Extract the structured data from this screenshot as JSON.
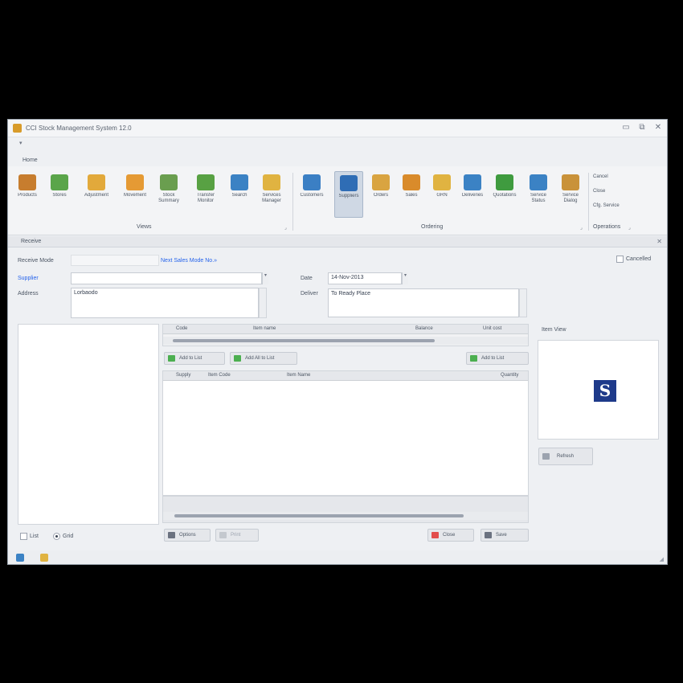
{
  "app": {
    "title": "CCI Stock Management System 12.0",
    "window_controls": {
      "minimize": "▭",
      "restore": "⧉",
      "close": "✕"
    },
    "qat_arrow": "▾"
  },
  "menu": {
    "active_tab": "Home"
  },
  "ribbon": {
    "groups": [
      {
        "label": "Views",
        "buttons": [
          {
            "label": "Products",
            "icon": "box-icon",
            "color": "#c77d2e"
          },
          {
            "label": "Stores",
            "icon": "store-icon",
            "color": "#5aa54a"
          },
          {
            "label": "Adjustment",
            "icon": "adjustment-icon",
            "color": "#e2a93b"
          },
          {
            "label": "Movement",
            "icon": "movement-icon",
            "color": "#e59a34"
          },
          {
            "label": "Stock Summary",
            "icon": "summary-icon",
            "color": "#6a9e4f"
          },
          {
            "label": "Transfer Monitor",
            "icon": "monitor-icon",
            "color": "#58a143"
          },
          {
            "label": "Search",
            "icon": "search-icon",
            "color": "#3b82c4"
          },
          {
            "label": "Services Manager",
            "icon": "services-icon",
            "color": "#e0b341"
          }
        ]
      },
      {
        "label": "Ordering",
        "buttons": [
          {
            "label": "Customers",
            "icon": "customers-icon",
            "color": "#3b7fc4"
          },
          {
            "label": "Suppliers",
            "icon": "suppliers-icon",
            "color": "#2f6db5"
          },
          {
            "label": "Orders",
            "icon": "orders-icon",
            "color": "#d9a441"
          },
          {
            "label": "Sales",
            "icon": "sales-icon",
            "color": "#d98b2b"
          },
          {
            "label": "GRN",
            "icon": "grn-icon",
            "color": "#e0b341"
          },
          {
            "label": "Deliveries",
            "icon": "deliveries-icon",
            "color": "#3b82c4"
          },
          {
            "label": "Quotations",
            "icon": "quotations-icon",
            "color": "#3f9b3f"
          },
          {
            "label": "Service Status",
            "icon": "service-status-icon",
            "color": "#3b82c4"
          },
          {
            "label": "Service Dialog",
            "icon": "service-dialog-icon",
            "color": "#c9923a"
          }
        ]
      },
      {
        "label": "Operations",
        "items": [
          "Cancel",
          "Close",
          "Cfg. Service"
        ]
      }
    ]
  },
  "doc_tab": {
    "label": "Receive",
    "close": "✕"
  },
  "form": {
    "receive_mode_label": "Receive Mode",
    "receive_mode_value": "",
    "next_mode_link": "Next Sales Mode No.»",
    "cancelled_label": "Cancelled",
    "supplier_label": "Supplier",
    "supplier_value": "",
    "date_label": "Date",
    "date_value": "14-Nov-2013",
    "address_label": "Address",
    "address_value": "Lorbaodo",
    "deliver_label": "Deliver",
    "deliver_value": "To Ready Place"
  },
  "top_grid": {
    "columns": [
      "Code",
      "Item name",
      "Balance",
      "Unit cost"
    ]
  },
  "actions": {
    "add_to_list": "Add to List",
    "add_all_to_list": "Add All to List",
    "add_to_list_right": "Add to List"
  },
  "bottom_grid": {
    "columns": [
      "Supply",
      "Item Code",
      "Item Name",
      "Quantity"
    ]
  },
  "left_panel": {
    "opt_list": "List",
    "opt_grid": "Grid"
  },
  "preview": {
    "label": "Item View",
    "logo_letter": "S",
    "refresh_button": "Refresh"
  },
  "footer_buttons": {
    "options": "Options",
    "print": "Print",
    "close": "Close",
    "save": "Save"
  },
  "status": {
    "grip": "◢"
  }
}
